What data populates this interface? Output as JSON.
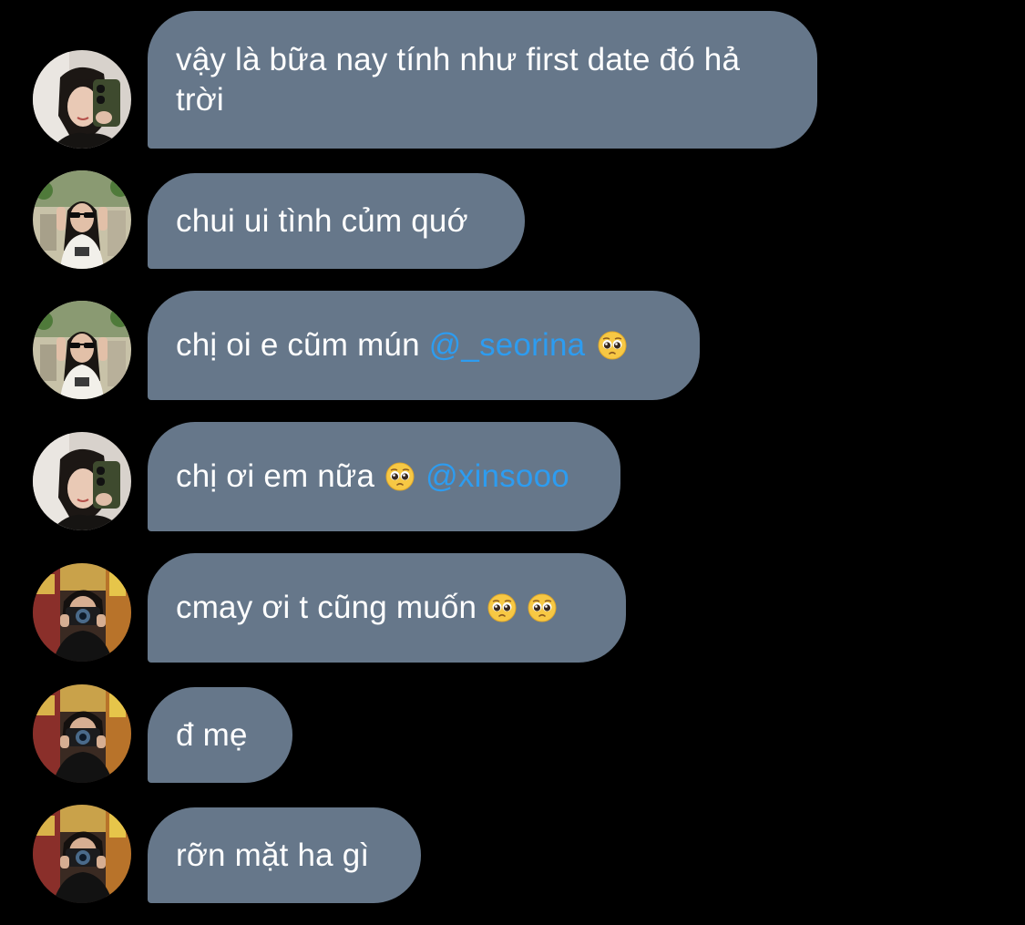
{
  "messages": [
    {
      "avatar": "avatar-girl-bangs-mirror",
      "parts": [
        "vậy là bữa nay tính như first date đó hả trời"
      ]
    },
    {
      "avatar": "avatar-girl-sunglasses",
      "parts": [
        "chui ui tình củm quớ"
      ]
    },
    {
      "avatar": "avatar-girl-sunglasses",
      "parts": [
        "chị oi e cũm mún "
      ],
      "mention": "@_seorina",
      "emojis": [
        "pleading-face-emoji"
      ]
    },
    {
      "avatar": "avatar-girl-bangs-mirror",
      "parts": [
        "chị ơi em nữa "
      ],
      "emojis_before_mention": [
        "pleading-face-emoji"
      ],
      "mention": "@xinsooo"
    },
    {
      "avatar": "avatar-camera-person",
      "parts": [
        "cmay ơi t cũng muốn "
      ],
      "emojis": [
        "pleading-face-emoji",
        "pleading-face-emoji"
      ]
    },
    {
      "avatar": "avatar-camera-person",
      "parts": [
        "đ mẹ"
      ]
    },
    {
      "avatar": "avatar-camera-person",
      "parts": [
        "rỡn mặt ha gì"
      ]
    }
  ],
  "colors": {
    "background": "#000000",
    "bubble": "#66778a",
    "text": "#ffffff",
    "mention": "#2d9cf0"
  }
}
